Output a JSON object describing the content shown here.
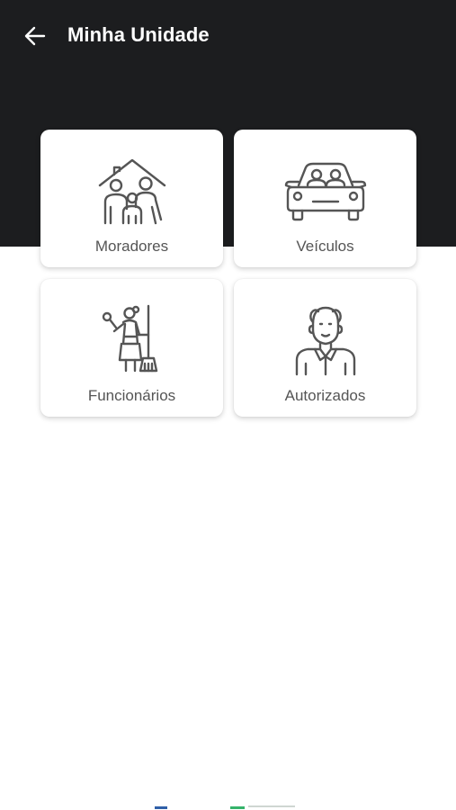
{
  "header": {
    "title": "Minha Unidade",
    "back_icon": "arrow-left-icon"
  },
  "colors": {
    "header_background": "#1c1d1f",
    "page_background": "#ffffff",
    "card_background": "#ffffff",
    "icon_color": "#555555",
    "label_color": "#555555"
  },
  "menu": {
    "items": [
      {
        "label": "Moradores",
        "icon": "family-house-icon"
      },
      {
        "label": "Veículos",
        "icon": "car-passengers-icon"
      },
      {
        "label": "Funcionários",
        "icon": "housekeeper-icon"
      },
      {
        "label": "Autorizados",
        "icon": "elderly-man-icon"
      }
    ]
  }
}
